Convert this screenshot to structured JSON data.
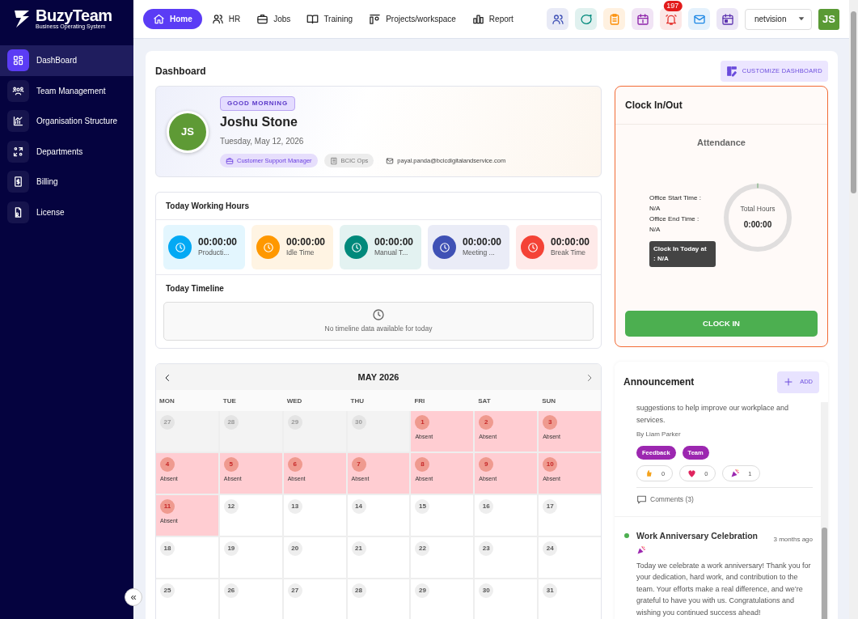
{
  "brand": {
    "name": "BuzyTeam",
    "tagline": "Business Operating System"
  },
  "sidebar": {
    "items": [
      {
        "label": "DashBoard",
        "selected": true
      },
      {
        "label": "Team Management",
        "selected": false
      },
      {
        "label": "Organisation Structure",
        "selected": false
      },
      {
        "label": "Departments",
        "selected": false
      },
      {
        "label": "Billing",
        "selected": false
      },
      {
        "label": "License",
        "selected": false
      }
    ],
    "collapse_button": "«"
  },
  "top_nav": {
    "items": [
      {
        "label": "Home",
        "selected": true
      },
      {
        "label": "HR",
        "selected": false
      },
      {
        "label": "Jobs",
        "selected": false
      },
      {
        "label": "Training",
        "selected": false
      },
      {
        "label": "Projects/workspace",
        "selected": false
      },
      {
        "label": "Report",
        "selected": false
      }
    ],
    "quick_actions": [
      {
        "color": "#3f51b5"
      },
      {
        "color": "#00897b"
      },
      {
        "color": "#fb8c00"
      },
      {
        "color": "#8e24aa"
      },
      {
        "color": "#e53935",
        "badge": "197"
      },
      {
        "color": "#1e88e5"
      },
      {
        "color": "#5e35b1"
      }
    ],
    "workspace_select": "netvision",
    "user_avatar": "JS"
  },
  "page": {
    "title": "Dashboard",
    "customize_button": "CUSTOMIZE DASHBOARD"
  },
  "profile": {
    "greeting": "GOOD MORNING",
    "avatar": "JS",
    "name": "Joshu Stone",
    "date": "Tuesday, May 12, 2026",
    "role": "Customer Support Manager",
    "department": "BCIC Ops",
    "email": "payal.panda@bcicdigitalandservice.com"
  },
  "working_hours": {
    "title": "Today Working Hours",
    "tiles": [
      {
        "value": "00:00:00",
        "label": "Producti...",
        "color": "#03a9f4"
      },
      {
        "value": "00:00:00",
        "label": "Idle Time",
        "color": "#ff9800"
      },
      {
        "value": "00:00:00",
        "label": "Manual T...",
        "color": "#00897b"
      },
      {
        "value": "00:00:00",
        "label": "Meeting ...",
        "color": "#3f51b5"
      },
      {
        "value": "00:00:00",
        "label": "Break Time",
        "color": "#f44336"
      }
    ],
    "timeline_title": "Today Timeline",
    "timeline_empty": "No timeline data available for today"
  },
  "calendar": {
    "month": "MAY 2026",
    "weekdays": [
      "MON",
      "TUE",
      "WED",
      "THU",
      "FRI",
      "SAT",
      "SUN"
    ],
    "days": [
      {
        "date": "27",
        "outside_month": true,
        "absent": false
      },
      {
        "date": "28",
        "outside_month": true,
        "absent": false
      },
      {
        "date": "29",
        "outside_month": true,
        "absent": false
      },
      {
        "date": "30",
        "outside_month": true,
        "absent": false
      },
      {
        "date": "1",
        "outside_month": false,
        "absent": true,
        "status": "Absent"
      },
      {
        "date": "2",
        "outside_month": false,
        "absent": true,
        "status": "Absent"
      },
      {
        "date": "3",
        "outside_month": false,
        "absent": true,
        "status": "Absent"
      },
      {
        "date": "4",
        "outside_month": false,
        "absent": true,
        "status": "Absent"
      },
      {
        "date": "5",
        "outside_month": false,
        "absent": true,
        "status": "Absent"
      },
      {
        "date": "6",
        "outside_month": false,
        "absent": true,
        "status": "Absent"
      },
      {
        "date": "7",
        "outside_month": false,
        "absent": true,
        "status": "Absent"
      },
      {
        "date": "8",
        "outside_month": false,
        "absent": true,
        "status": "Absent"
      },
      {
        "date": "9",
        "outside_month": false,
        "absent": true,
        "status": "Absent"
      },
      {
        "date": "10",
        "outside_month": false,
        "absent": true,
        "status": "Absent"
      },
      {
        "date": "11",
        "outside_month": false,
        "absent": true,
        "status": "Absent"
      },
      {
        "date": "12",
        "outside_month": false,
        "absent": false
      },
      {
        "date": "13",
        "outside_month": false,
        "absent": false
      },
      {
        "date": "14",
        "outside_month": false,
        "absent": false
      },
      {
        "date": "15",
        "outside_month": false,
        "absent": false
      },
      {
        "date": "16",
        "outside_month": false,
        "absent": false
      },
      {
        "date": "17",
        "outside_month": false,
        "absent": false
      },
      {
        "date": "18",
        "outside_month": false,
        "absent": false
      },
      {
        "date": "19",
        "outside_month": false,
        "absent": false
      },
      {
        "date": "20",
        "outside_month": false,
        "absent": false
      },
      {
        "date": "21",
        "outside_month": false,
        "absent": false
      },
      {
        "date": "22",
        "outside_month": false,
        "absent": false
      },
      {
        "date": "23",
        "outside_month": false,
        "absent": false
      },
      {
        "date": "24",
        "outside_month": false,
        "absent": false
      },
      {
        "date": "25",
        "outside_month": false,
        "absent": false
      },
      {
        "date": "26",
        "outside_month": false,
        "absent": false
      },
      {
        "date": "27",
        "outside_month": false,
        "absent": false
      },
      {
        "date": "28",
        "outside_month": false,
        "absent": false
      },
      {
        "date": "29",
        "outside_month": false,
        "absent": false
      },
      {
        "date": "30",
        "outside_month": false,
        "absent": false
      },
      {
        "date": "31",
        "outside_month": false,
        "absent": false
      }
    ]
  },
  "clock": {
    "title": "Clock In/Out",
    "subtitle": "Attendance",
    "start_label": "Office Start Time :",
    "start_value": "N/A",
    "end_label": "Office End Time  :",
    "end_value": "N/A",
    "clock_in_label": "Clock In Today at",
    "clock_in_value": ": N/A",
    "total_label": "Total Hours",
    "total_value": "0:00:00",
    "button": "CLOCK IN"
  },
  "announcements": {
    "title": "Announcement",
    "add_button": "ADD",
    "items": [
      {
        "body": "suggestions to help improve our workplace and services.",
        "author": "By Liam Parker",
        "tags": [
          "Feedback",
          "Team"
        ],
        "reactions": [
          "0",
          "0",
          "1"
        ],
        "comments": "Comments (3)"
      },
      {
        "title": "Work Anniversary Celebration",
        "time": "3 months ago",
        "color": "#4caf50",
        "body": "Today we celebrate a work anniversary! Thank you for your dedication, hard work, and contribution to the team. Your efforts make a real difference, and we’re grateful to have you with us. Congratulations and wishing you continued success ahead!"
      }
    ]
  }
}
